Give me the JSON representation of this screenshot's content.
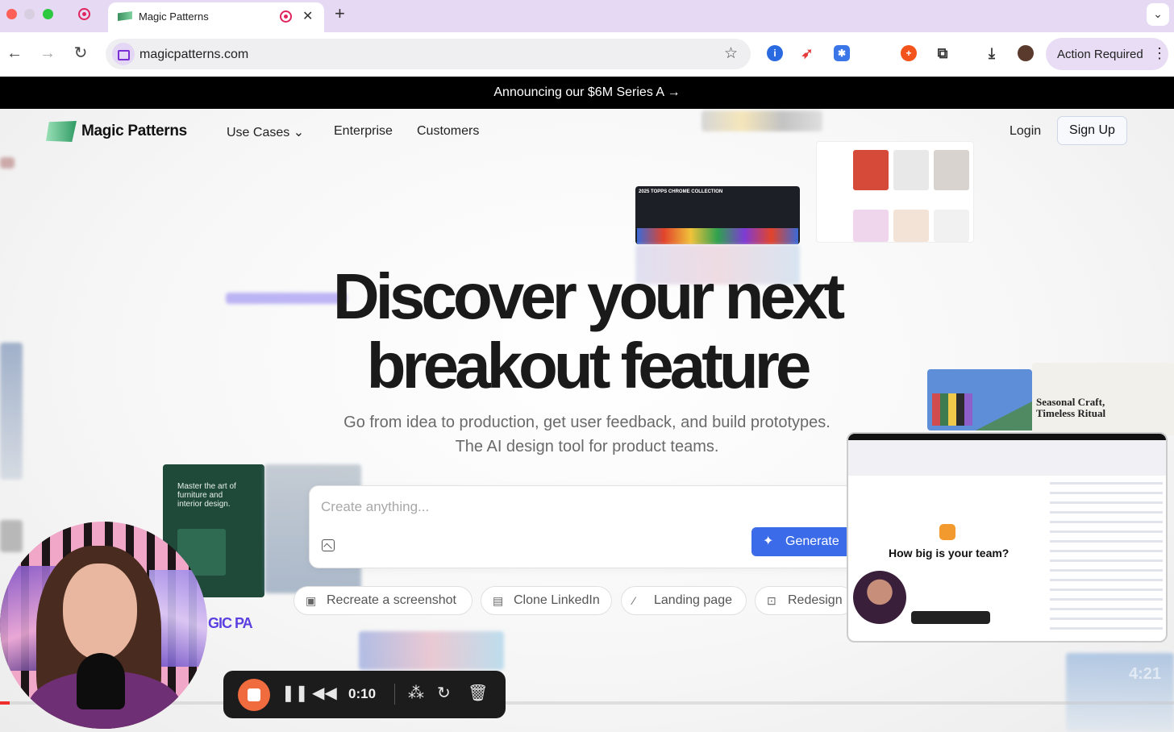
{
  "browser": {
    "tab": {
      "title": "Magic Patterns"
    },
    "address": {
      "url": "magicpatterns.com"
    },
    "action_button": "Action Required",
    "colors": {
      "tabbar": "#e6d9f3",
      "record": "#e0245e"
    }
  },
  "banner": {
    "text": "Announcing our $6M Series A →"
  },
  "site": {
    "logo": "Magic Patterns",
    "nav": [
      {
        "label": "Use Cases ⌄"
      },
      {
        "label": "Enterprise"
      },
      {
        "label": "Customers"
      }
    ],
    "login": "Login",
    "signup": "Sign Up"
  },
  "hero": {
    "title_line1": "Discover your next",
    "title_line2": "breakout feature",
    "subtitle_line1": "Go from idea to production, get user feedback, and build prototypes.",
    "subtitle_line2": "The AI design tool for product teams."
  },
  "prompt": {
    "placeholder": "Create anything...",
    "generate": "Generate",
    "accent": "#3b6be8"
  },
  "suggestions": [
    {
      "label": "Recreate a screenshot",
      "icon": "image-search-icon"
    },
    {
      "label": "Clone LinkedIn",
      "icon": "linkedin-icon"
    },
    {
      "label": "Landing page",
      "icon": "magic-wand-icon"
    },
    {
      "label": "Redesign",
      "icon": "redesign-icon"
    }
  ],
  "floating": {
    "video_question": "How big is your team?",
    "seasonal_line1": "Seasonal Craft,",
    "seasonal_line2": "Timeless Ritual",
    "interior_card_line1": "Master the art of",
    "interior_card_line2": "furniture and",
    "interior_card_line3": "interior design.",
    "cards_title": "2025 TOPPS CHROME COLLECTION",
    "magic_pa": "GIC PA"
  },
  "recorder": {
    "elapsed": "0:10",
    "progress_fraction": 0.008,
    "stop_color": "#f06b3e"
  }
}
